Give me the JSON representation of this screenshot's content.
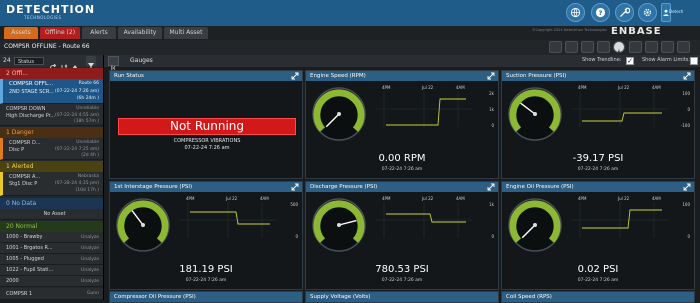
{
  "header": {
    "logo_main": "DETECHTION",
    "logo_sub": "TECHNOLOGIES",
    "user_name": "Detech"
  },
  "tabs": [
    {
      "label": "Assets",
      "color": "#d46a1b"
    },
    {
      "label": "Offline (2)",
      "color": "#b31d1d"
    },
    {
      "label": "Alerts",
      "color": "#3a3e42"
    },
    {
      "label": "Availability",
      "color": "#3a3e42"
    },
    {
      "label": "Multi Asset",
      "color": "#3a3e42"
    }
  ],
  "copyright": "©Copyright 2024 Detechtion Technologies",
  "brand": "ENBASE",
  "location": "COMPSR OFFLINE - Route 66",
  "sidebar": {
    "count": "24",
    "status_label": "Status",
    "offline_group_label": "2 Offl...",
    "offline_items": [
      {
        "name": "COMPSR OFFL...",
        "sub": "2ND STAGE SCR...",
        "route": "Route 66",
        "time": "(07-22-24 7:26 am)",
        "dur": "(6h 24m )"
      },
      {
        "name": "COMPSR DOWN",
        "sub": "High Discharge Pr...",
        "route": "Unreliable",
        "time": "(07-22-24 4:55 am)",
        "dur": "(18h 57m )"
      }
    ],
    "danger_label": "1   Danger",
    "danger_item": {
      "name": "COMPSR D...",
      "sub": "Disc P",
      "route": "Unreliable",
      "time": "(07-22-24 7:25 am)",
      "dur": "(2d 4h )"
    },
    "alerted_label": "1   Alerted",
    "alerted_item": {
      "name": "COMPSR A...",
      "sub": "Stg1 Disc P",
      "route": "Nebraska",
      "time": "(07-28-24 4:35 pm)",
      "dur": "(10d 17h )"
    },
    "nodata_label": "0   No Data",
    "nodata_text": "No Asset",
    "normal_label": "20   Normal",
    "normal_items": [
      {
        "name": "1000 - Brawby",
        "route": "Unalyze"
      },
      {
        "name": "1001 - Brgatos R...",
        "route": "Unalyze"
      },
      {
        "name": "1005 - Plugged",
        "route": "Unalyze"
      },
      {
        "name": "1022 - Fupil Stati...",
        "route": "Unalyze"
      },
      {
        "name": "2000",
        "route": "Unalyze"
      },
      {
        "name": "COMPSR 1",
        "route": "Gunn"
      }
    ]
  },
  "toolbar": {
    "gauges_label": "Gauges",
    "trendline_label": "Show Trendline:",
    "alarm_limits_label": "Show Alarm Limits:"
  },
  "run_status": {
    "title": "Run Status",
    "status": "Not Running",
    "reason": "COMPRESSOR VIBRATIONS",
    "time": "07-22-24 7:26 am"
  },
  "gauges": [
    {
      "title": "Engine Speed (RPM)",
      "reading": "0.00 RPM",
      "time": "07-22-24 7:26 am",
      "value": 0,
      "t1": "4PM",
      "t2": "Jul 22",
      "t3": "4AM",
      "s1": "2k",
      "s2": "1k",
      "s3": "0"
    },
    {
      "title": "Suction Pressure (PSI)",
      "reading": "-39.17 PSI",
      "time": "07-22-24 7:26 am",
      "value": -39.17,
      "t1": "4PM",
      "t2": "Jul 22",
      "t3": "4AM",
      "s1": "100",
      "s2": "0",
      "s3": "-100"
    },
    {
      "title": "1st Interstage Pressure (PSI)",
      "reading": "181.19 PSI",
      "time": "07-22-24 7:26 am",
      "value": 181.19,
      "t1": "4PM",
      "t2": "Jul 22",
      "t3": "4AM",
      "s1": "500",
      "s2": "",
      "s3": "0"
    },
    {
      "title": "Discharge Pressure (PSI)",
      "reading": "780.53 PSI",
      "time": "07-22-24 7:26 am",
      "value": 780.53,
      "t1": "4PM",
      "t2": "Jul 22",
      "t3": "4AM",
      "s1": "1k",
      "s2": "",
      "s3": "0"
    },
    {
      "title": "Engine Oil Pressure (PSI)",
      "reading": "0.02 PSI",
      "time": "07-22-24 7:26 am",
      "value": 0.02,
      "t1": "4PM",
      "t2": "Jul 22",
      "t3": "4AM",
      "s1": "100",
      "s2": "",
      "s3": "0"
    }
  ],
  "bottom_panels": [
    {
      "title": "Compressor Oil Pressure (PSI)"
    },
    {
      "title": "Supply Voltage (Volts)"
    },
    {
      "title": "Coil Speed (RPS)"
    }
  ],
  "colors": {
    "header": "#1f5c8a",
    "panel_title": "#2d5f84",
    "gauge_green": "#8db833",
    "alarm_red": "#d21818",
    "trend": "#c8d23a"
  }
}
